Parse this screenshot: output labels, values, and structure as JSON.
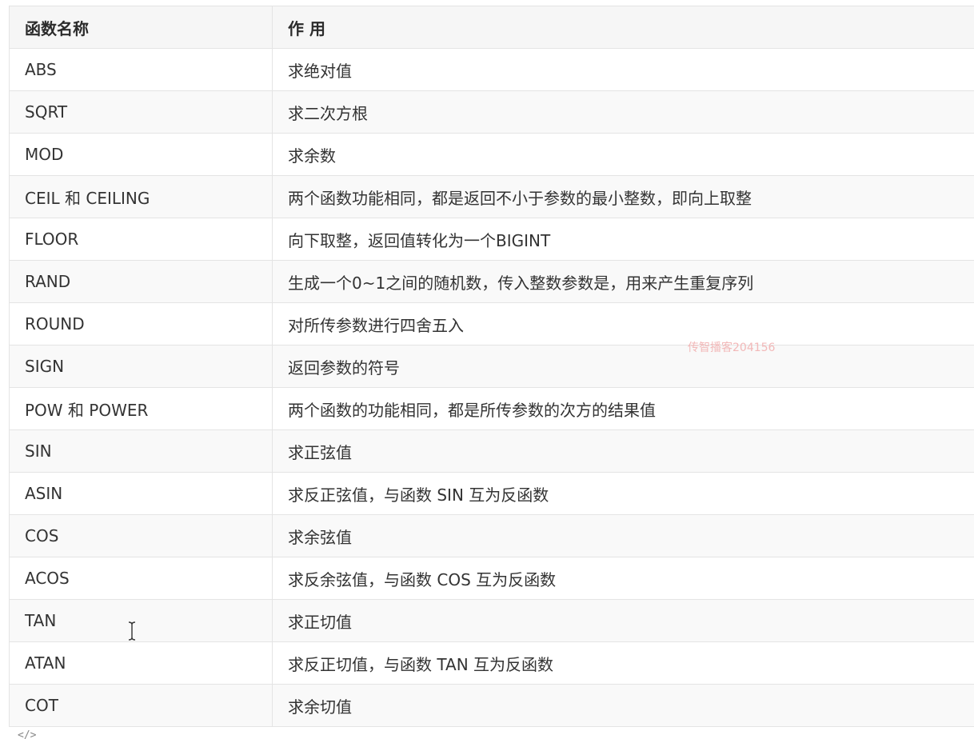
{
  "table": {
    "headers": [
      "函数名称",
      "作 用"
    ],
    "rows": [
      {
        "name": "ABS",
        "desc": "求绝对值"
      },
      {
        "name": "SQRT",
        "desc": "求二次方根"
      },
      {
        "name": "MOD",
        "desc": "求余数"
      },
      {
        "name": "CEIL 和 CEILING",
        "desc": "两个函数功能相同，都是返回不小于参数的最小整数，即向上取整"
      },
      {
        "name": "FLOOR",
        "desc": "向下取整，返回值转化为一个BIGINT"
      },
      {
        "name": "RAND",
        "desc": "生成一个0~1之间的随机数，传入整数参数是，用来产生重复序列"
      },
      {
        "name": "ROUND",
        "desc": "对所传参数进行四舍五入"
      },
      {
        "name": "SIGN",
        "desc": "返回参数的符号"
      },
      {
        "name": "POW 和 POWER",
        "desc": "两个函数的功能相同，都是所传参数的次方的结果值"
      },
      {
        "name": "SIN",
        "desc": "求正弦值"
      },
      {
        "name": "ASIN",
        "desc": "求反正弦值，与函数 SIN 互为反函数"
      },
      {
        "name": "COS",
        "desc": "求余弦值"
      },
      {
        "name": "ACOS",
        "desc": "求反余弦值，与函数 COS 互为反函数"
      },
      {
        "name": "TAN",
        "desc": "求正切值"
      },
      {
        "name": "ATAN",
        "desc": "求反正切值，与函数 TAN 互为反函数"
      },
      {
        "name": "COT",
        "desc": "求余切值"
      }
    ]
  },
  "watermark": "传智播客204156",
  "footer_icon_text": "</>",
  "colors": {
    "header_bg": "#f6f6f6",
    "stripe_bg": "#f9f9f9",
    "border": "#e4e4e4",
    "text": "#333333",
    "watermark": "#f2b8b8"
  },
  "icons": [
    "text-cursor-icon",
    "code-icon"
  ]
}
